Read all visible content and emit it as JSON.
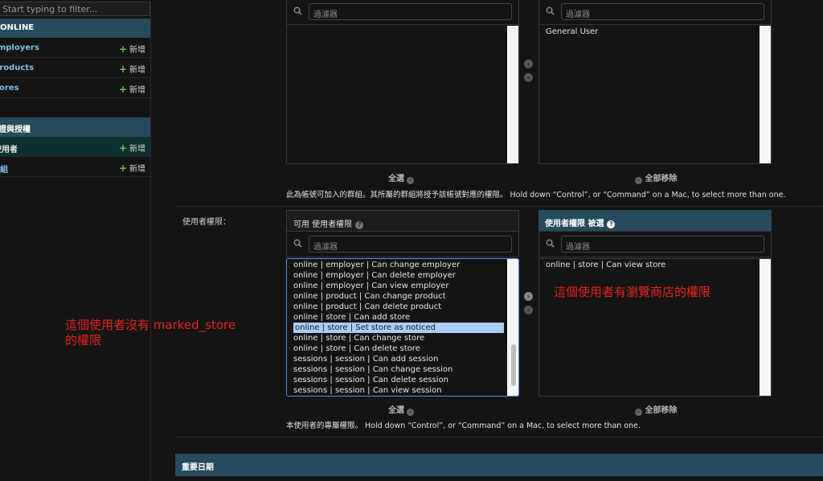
{
  "sidebar": {
    "filter_placeholder": "Start typing to filter...",
    "sections": [
      {
        "title": "ONLINE",
        "items": [
          {
            "label": "Employers",
            "add": "新增"
          },
          {
            "label": "Products",
            "add": "新增"
          },
          {
            "label": "Stores",
            "add": "新增"
          }
        ]
      },
      {
        "title": "認證與授權",
        "items": [
          {
            "label": "使用者",
            "add": "新增"
          },
          {
            "label": "群組",
            "add": "新增"
          }
        ]
      }
    ]
  },
  "groups": {
    "filter_placeholder": "過濾器",
    "chosen_filter_placeholder": "過濾器",
    "chosen_items": [
      "General User"
    ],
    "choose_all": "全選",
    "remove_all": "全部移除",
    "help": "此為帳號可加入的群組。其所屬的群組將授予該帳號對應的權限。 Hold down “Control”, or “Command” on a Mac, to select more than one."
  },
  "permissions": {
    "label": "使用者權限：",
    "available_title": "可用 使用者權限",
    "chosen_title": "使用者權限 被選",
    "filter_placeholder": "過濾器",
    "chosen_filter_placeholder": "過濾器",
    "available_items": [
      "online | employer | Can change employer",
      "online | employer | Can delete employer",
      "online | employer | Can view employer",
      "online | product | Can change product",
      "online | product | Can delete product",
      "online | store | Can add store",
      "online | store | Set store as noticed",
      "online | store | Can change store",
      "online | store | Can delete store",
      "sessions | session | Can add session",
      "sessions | session | Can change session",
      "sessions | session | Can delete session",
      "sessions | session | Can view session"
    ],
    "highlighted_item": "online | store | Set store as noticed",
    "chosen_items": [
      "online | store | Can view store"
    ],
    "choose_all": "全選",
    "remove_all": "全部移除",
    "help": "本使用者的專屬權限。 Hold down “Control”, or “Command” on a Mac, to select more than one."
  },
  "dates_section": "重要日期",
  "annotations": {
    "left_line1": "這個使用者沒有 marked_store",
    "left_line2": "的權限",
    "right": "這個使用者有瀏覽商店的權限"
  },
  "colors": {
    "header": "#264b5d",
    "link": "#79c0e5",
    "add_plus": "#6cc24a",
    "annotation": "#e8231b",
    "highlight": "#a9cdf5"
  }
}
